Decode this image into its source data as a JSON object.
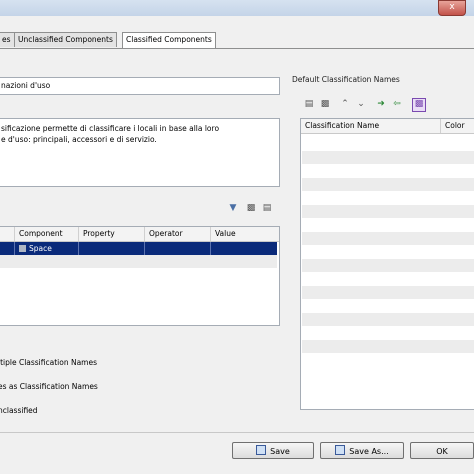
{
  "window": {
    "close_glyph": "x"
  },
  "tabs": [
    {
      "label": "es"
    },
    {
      "label": "Unclassified Components"
    },
    {
      "label": "Classified Components"
    }
  ],
  "name_field": {
    "value": "nazioni d'uso"
  },
  "description": {
    "line1": "sificazione permette di classificare i locali in base alla loro",
    "line2": "e d'uso: principali, accessori e di servizio."
  },
  "component_table": {
    "columns": [
      "Component",
      "Property",
      "Operator",
      "Value"
    ],
    "rows": [
      {
        "component": "Space",
        "property": "",
        "operator": "",
        "value": ""
      }
    ]
  },
  "options": [
    {
      "label": "ltiple Classification Names"
    },
    {
      "label": "es as Classification Names"
    },
    {
      "label": "nclassified"
    }
  ],
  "right_panel": {
    "title": "Default Classification Names",
    "columns": [
      "Classification Name",
      "Color"
    ]
  },
  "buttons": {
    "save": "Save",
    "save_as": "Save As...",
    "ok": "OK"
  },
  "icons": {
    "folder": "folder-open-icon",
    "copy": "copy-icon",
    "print": "print-icon"
  }
}
